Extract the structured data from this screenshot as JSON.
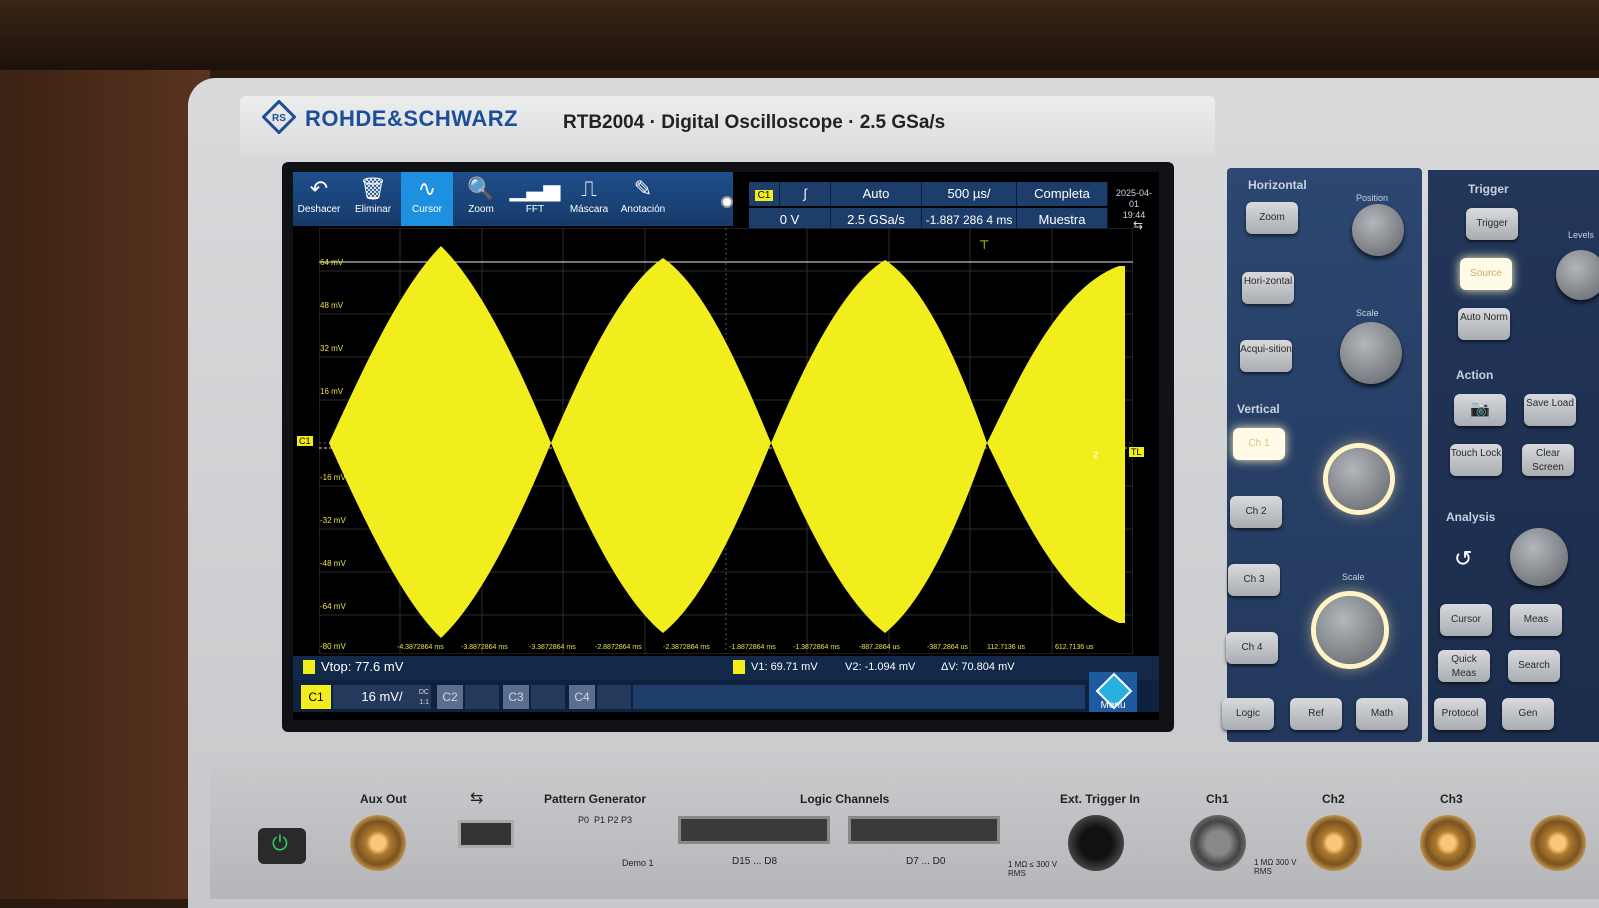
{
  "device": {
    "brand": "ROHDE&SCHWARZ",
    "model": "RTB2004 · Digital Oscilloscope · 2.5 GSa/s"
  },
  "toolbar": [
    {
      "label": "Deshacer",
      "icon": "undo-icon"
    },
    {
      "label": "Eliminar",
      "icon": "trash-icon"
    },
    {
      "label": "Cursor",
      "icon": "cursor-wave-icon",
      "active": true
    },
    {
      "label": "Zoom",
      "icon": "zoom-icon"
    },
    {
      "label": "FFT",
      "icon": "fft-icon"
    },
    {
      "label": "Máscara",
      "icon": "mask-icon"
    },
    {
      "label": "Anotación",
      "icon": "pencil-icon"
    }
  ],
  "status": {
    "trigger_channel": "C1",
    "trigger_slope": "∫",
    "trigger_level": "0 V",
    "trigger_mode": "Auto",
    "timebase": "500 µs/",
    "sample_rate": "2.5 GSa/s",
    "position": "-1.887 286 4 ms",
    "acq_mode": "Completa",
    "acq_type": "Muestra",
    "date": "2025-04-01",
    "time": "19:44"
  },
  "grid": {
    "y_labels": [
      "64 mV",
      "48 mV",
      "32 mV",
      "16 mV",
      "-16 mV",
      "-32 mV",
      "-48 mV",
      "-64 mV",
      "-80 mV"
    ],
    "x_labels": [
      "-4.3872864 ms",
      "-3.8872864 ms",
      "-3.3872864 ms",
      "-2.8872864 ms",
      "-2.3872864 ms",
      "-1.8872864 ms",
      "-1.3872864 ms",
      "-887.2864 us",
      "-387.2864 us",
      "112.7136 us",
      "612.7136 us"
    ],
    "ch_marker": "C1",
    "tl_marker": "TL",
    "cursor_marker": "2"
  },
  "readout": {
    "vtop": "Vtop: 77.6 mV",
    "v1": "V1: 69.71 mV",
    "v2": "V2: -1.094 mV",
    "dv": "ΔV: 70.804 mV"
  },
  "channels": {
    "c1": "C1",
    "c1_scale": "16 mV/",
    "c1_coupling": "DC",
    "c1_extra": "1:1",
    "c2": "C2",
    "c3": "C3",
    "c4": "C4",
    "menu": "Menu"
  },
  "panel": {
    "horizontal": "Horizontal",
    "zoom": "Zoom",
    "horizontal_btn": "Hori-zontal",
    "acquisition": "Acqui-sition",
    "position": "Position",
    "scale": "Scale",
    "vertical": "Vertical",
    "ch1": "Ch 1",
    "ch2": "Ch 2",
    "ch3": "Ch 3",
    "ch4": "Ch 4",
    "logic": "Logic",
    "ref": "Ref",
    "math": "Math",
    "trigger_title": "Trigger",
    "trigger_btn": "Trigger",
    "source": "Source",
    "auto_norm": "Auto Norm",
    "action": "Action",
    "touch_lock": "Touch Lock",
    "clear_screen": "Clear Screen",
    "save_load": "Save Load",
    "analysis": "Analysis",
    "cursor": "Cursor",
    "meas": "Meas",
    "quick_meas": "Quick Meas",
    "search": "Search",
    "protocol": "Protocol",
    "gen": "Gen",
    "levels": "Levels",
    "vscale": "Scale"
  },
  "front": {
    "aux_out": "Aux Out",
    "pattern_generator": "Pattern Generator",
    "pattern_pins": "P0  P1 P2 P3",
    "demo": "Demo 1",
    "logic_channels": "Logic Channels",
    "d15_d8": "D15 ... D8",
    "d7_d0": "D7 ... D0",
    "ext_trigger": "Ext. Trigger In",
    "ext_rating": "1 MΩ ≤ 300 V RMS",
    "ch1": "Ch1",
    "ch2": "Ch2",
    "ch3": "Ch3",
    "ch_rating": "1 MΩ 300 V RMS"
  },
  "colors": {
    "trace": "#f2ee1e",
    "accent": "#1e90e0",
    "brand": "#1d4f98"
  }
}
